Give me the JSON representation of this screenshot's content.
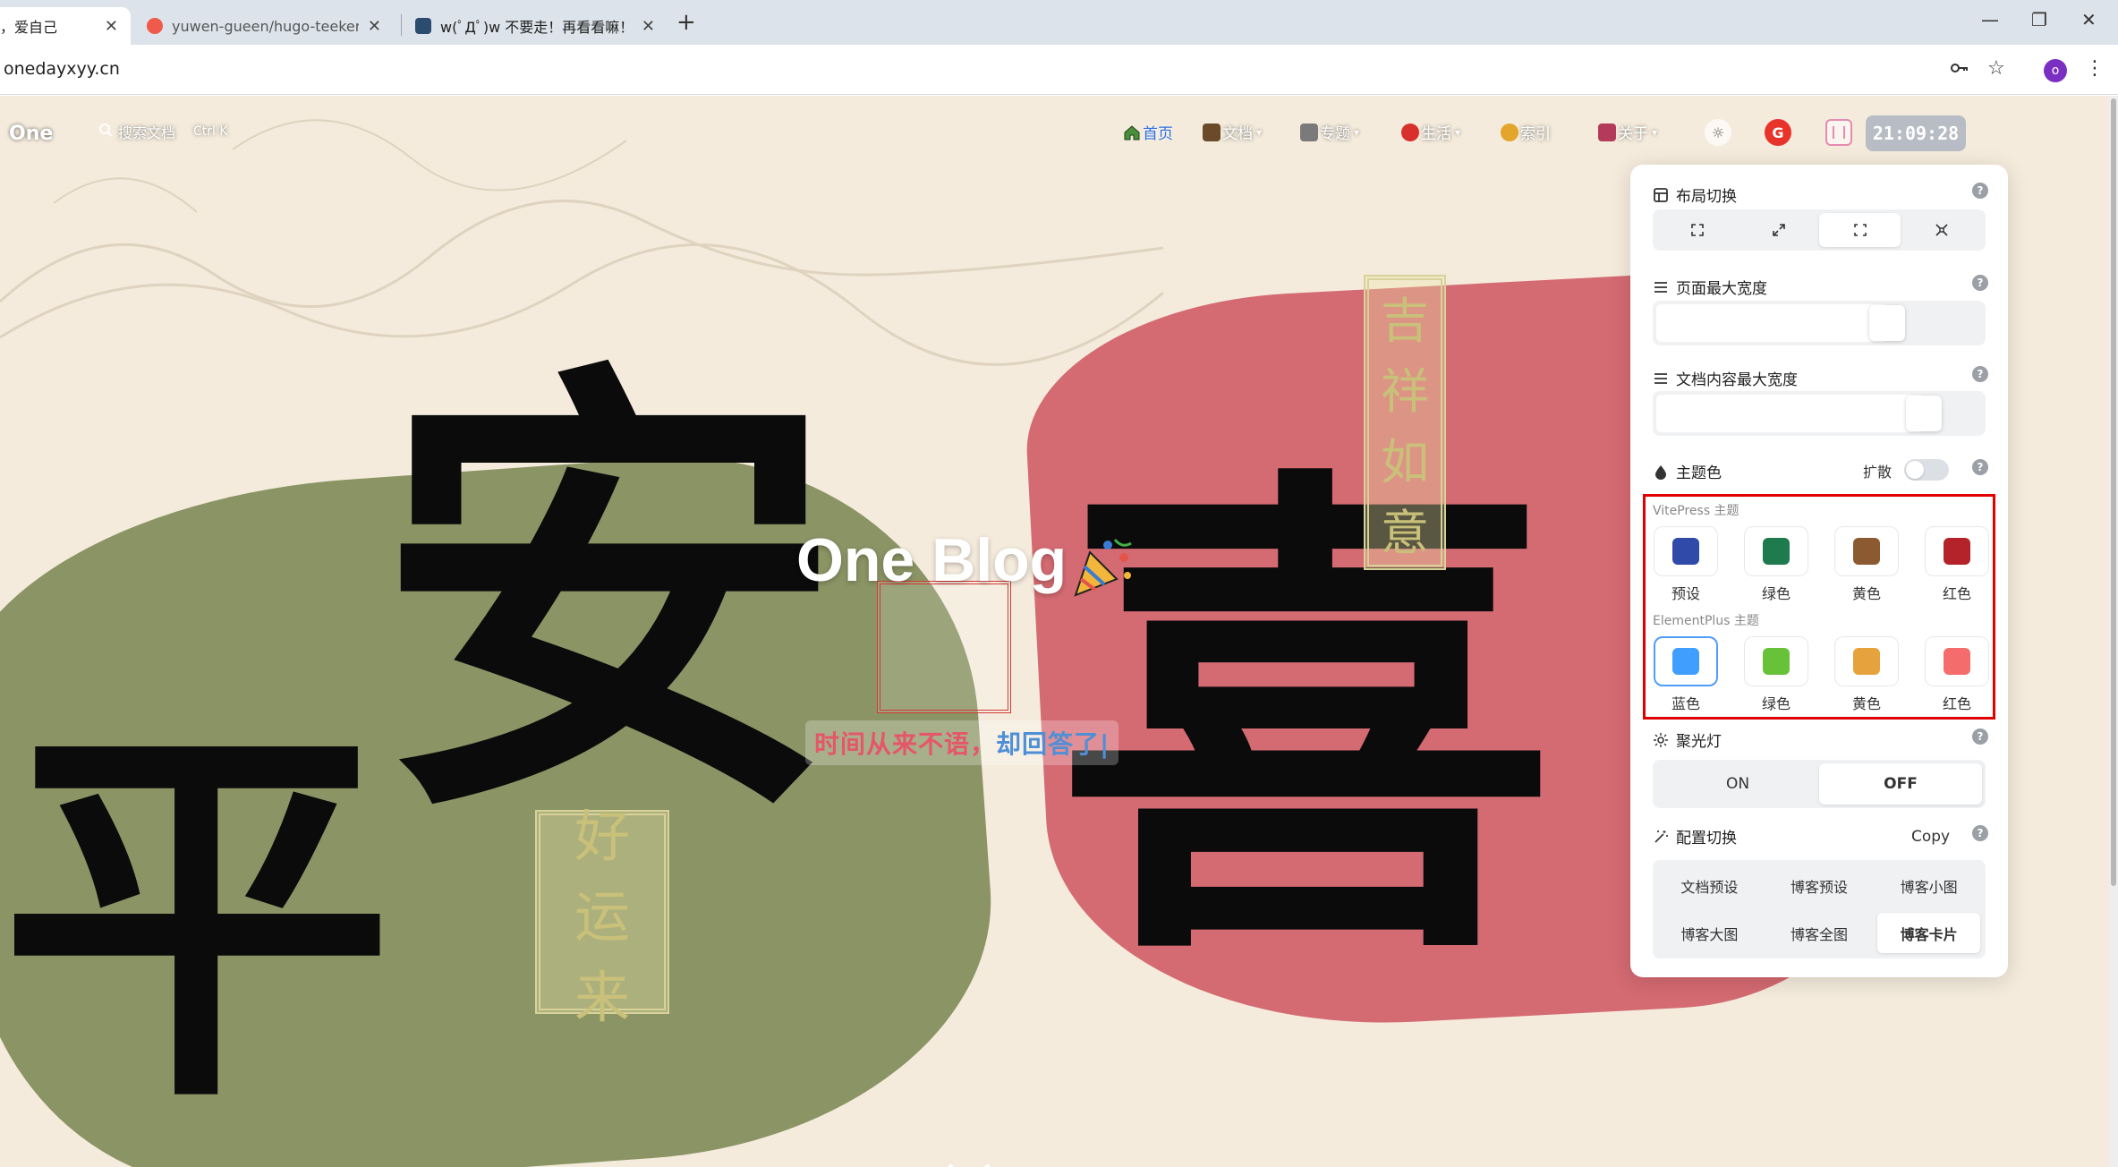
{
  "browser": {
    "tabs": [
      {
        "title": "，爱自己",
        "active": true,
        "favicon_color": "#e9e9e9"
      },
      {
        "title": "yuwen-gueen/hugo-teeker-t",
        "active": false,
        "favicon_color": "#f05a4a"
      },
      {
        "title": "w(ﾟДﾟ)w 不要走！再看看嘛！",
        "active": false,
        "favicon_color": "#2b4b6f"
      }
    ],
    "new_tab": "+",
    "url": "onedayxyy.cn",
    "profile_initial": "o",
    "window_controls": {
      "minimize": "—",
      "restore": "❐",
      "close": "✕"
    }
  },
  "site": {
    "logo": "One",
    "search_label": "搜索文档",
    "search_shortcut": "Ctrl K",
    "nav": [
      {
        "label": "首页",
        "icon": "home-icon",
        "active": true,
        "dropdown": false
      },
      {
        "label": "文档",
        "icon": "docs-icon",
        "active": false,
        "dropdown": true
      },
      {
        "label": "专题",
        "icon": "tools-icon",
        "active": false,
        "dropdown": true
      },
      {
        "label": "生活",
        "icon": "life-icon",
        "active": false,
        "dropdown": true
      },
      {
        "label": "索引",
        "icon": "index-icon",
        "active": false,
        "dropdown": false
      },
      {
        "label": "关于",
        "icon": "about-icon",
        "active": false,
        "dropdown": true
      }
    ],
    "clock": "21:09:28"
  },
  "hero": {
    "title": "One Blog",
    "tagline_part1": "时间从来不语，",
    "tagline_part2": "却回答了|",
    "chars": {
      "an": "安",
      "ping": "平",
      "xi": "喜"
    },
    "seal_good_luck": [
      "好",
      "运",
      "来"
    ],
    "seal_auspicious": [
      "吉",
      "祥",
      "如",
      "意"
    ]
  },
  "panel": {
    "layout_title": "布局切换",
    "page_width_title": "页面最大宽度",
    "page_width_value": 0.75,
    "doc_width_title": "文档内容最大宽度",
    "doc_width_value": 0.87,
    "theme_title": "主题色",
    "spread_label": "扩散",
    "spread_on": false,
    "vitepress_label": "VitePress 主题",
    "vitepress_themes": [
      {
        "label": "预设",
        "color": "#2f4aa8"
      },
      {
        "label": "绿色",
        "color": "#1f7a4d"
      },
      {
        "label": "黄色",
        "color": "#8c5a30"
      },
      {
        "label": "红色",
        "color": "#b5232a"
      }
    ],
    "element_label": "ElementPlus 主题",
    "element_themes": [
      {
        "label": "蓝色",
        "color": "#409eff",
        "selected": true
      },
      {
        "label": "绿色",
        "color": "#67c23a"
      },
      {
        "label": "黄色",
        "color": "#e6a23c"
      },
      {
        "label": "红色",
        "color": "#f56c6c"
      }
    ],
    "spotlight_title": "聚光灯",
    "spotlight_on": "ON",
    "spotlight_off": "OFF",
    "config_title": "配置切换",
    "copy_label": "Copy",
    "presets": [
      "文档预设",
      "博客预设",
      "博客小图",
      "博客大图",
      "博客全图",
      "博客卡片"
    ],
    "help": "?"
  }
}
